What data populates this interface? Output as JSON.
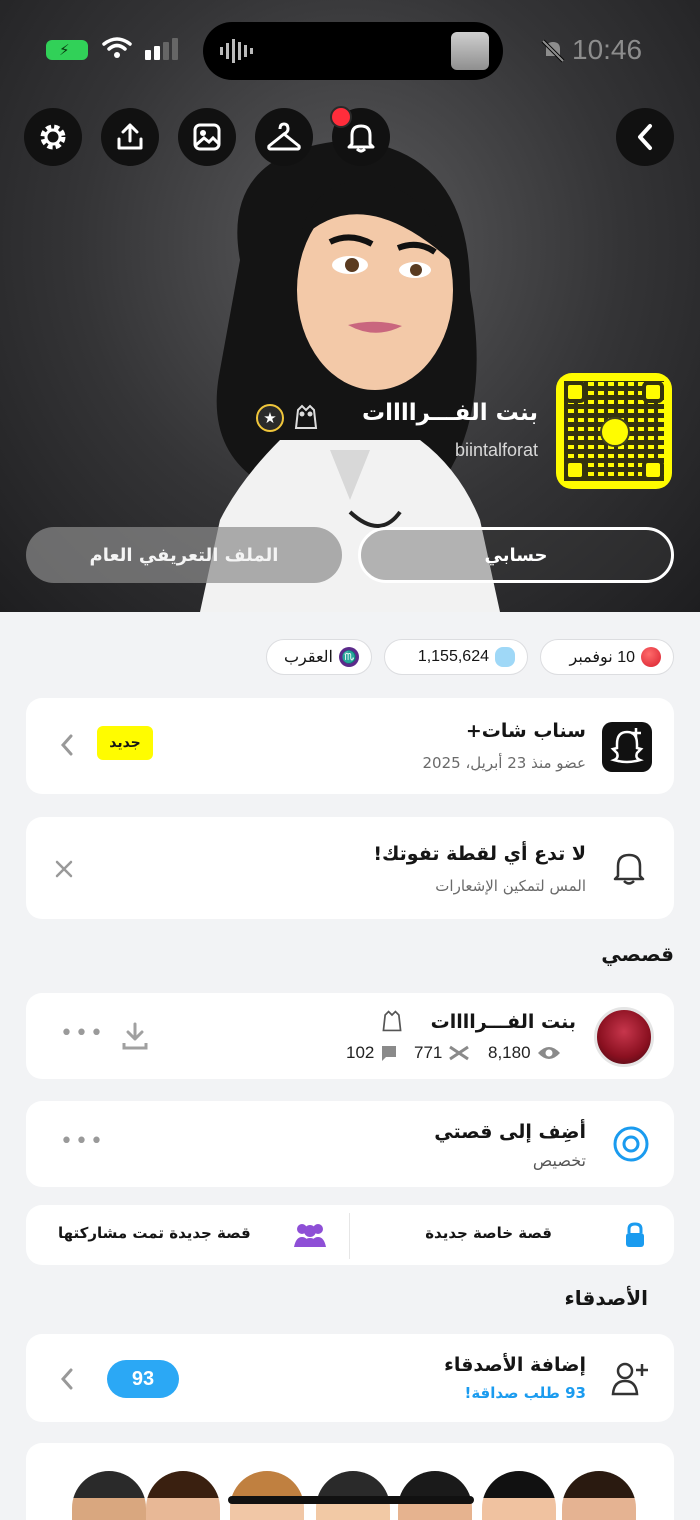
{
  "status_bar": {
    "time": "10:46"
  },
  "profile": {
    "display_name": "بنت الفـــراااات",
    "username": "biintalforat",
    "tabs": {
      "account": "حسابي",
      "public_profile": "الملف التعريفي العام"
    }
  },
  "chips": {
    "birthday": "10 نوفمبر",
    "snap_score": "1,155,624",
    "zodiac": "العقرب"
  },
  "snapchat_plus": {
    "title": "سناب شات+",
    "subtitle": "عضو منذ 23 أبريل، 2025",
    "badge": "جديد"
  },
  "notifications_card": {
    "title": "لا تدع أي لقطة تفوتك!",
    "subtitle": "المس لتمكين الإشعارات"
  },
  "stories_section": {
    "heading": "قصصي",
    "my_story": {
      "name": "بنت الفـــراااات",
      "views": "8,180",
      "screenshots": "771",
      "replies": "102"
    },
    "add_story": {
      "title": "أضِف إلى قصتي",
      "subtitle": "تخصيص"
    },
    "new_private_story": "قصة خاصة جديدة",
    "new_shared_story": "قصة جديدة تمت مشاركتها"
  },
  "friends_section": {
    "heading": "الأصدقاء",
    "add_friends": {
      "title": "إضافة الأصدقاء",
      "subtitle": "93 طلب صداقة!",
      "count": "93"
    }
  },
  "colors": {
    "snap_yellow": "#fffc00",
    "accent_blue": "#2ba8f5",
    "alert_red": "#ff2d3b",
    "story_purple": "#8e4fd6"
  }
}
